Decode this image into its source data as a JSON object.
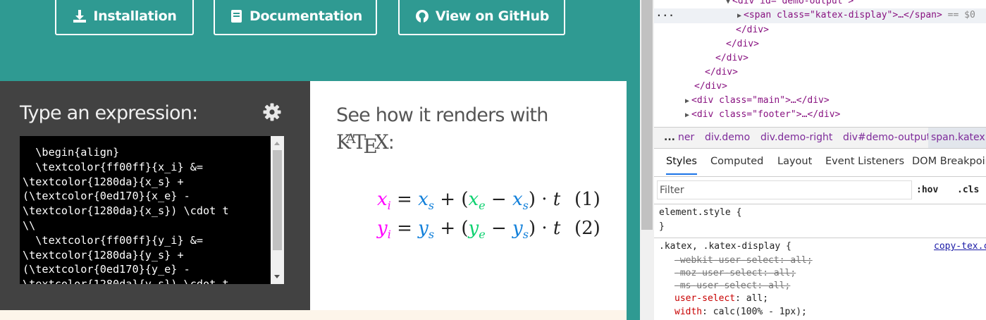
{
  "hero": {
    "installation": "Installation",
    "documentation": "Documentation",
    "github": "View on GitHub"
  },
  "demo": {
    "input_heading": "Type an expression:",
    "source": "  \\begin{align}\n  \\textcolor{ff00ff}{x_i} &=\n\\textcolor{1280da}{x_s} +\n(\\textcolor{0ed170}{x_e} -\n\\textcolor{1280da}{x_s}) \\cdot t\n\\\\\n  \\textcolor{ff00ff}{y_i} &=\n\\textcolor{1280da}{y_s} +\n(\\textcolor{0ed170}{y_e} -\n\\textcolor{1280da}{y_s}) \\cdot t",
    "output_heading": "See how it renders with",
    "logo": {
      "k": "K",
      "a": "A",
      "t": "T",
      "e": "E",
      "x": "X",
      "colon": ":"
    },
    "rows": [
      {
        "lhs": "x",
        "lhs_sub": "i",
        "a": "x",
        "a_sub": "s",
        "b": "x",
        "b_sub": "e",
        "c": "x",
        "c_sub": "s",
        "var": "t",
        "tag": "(1)"
      },
      {
        "lhs": "y",
        "lhs_sub": "i",
        "a": "y",
        "a_sub": "s",
        "b": "y",
        "b_sub": "e",
        "c": "y",
        "c_sub": "s",
        "var": "t",
        "tag": "(2)"
      }
    ],
    "colors": {
      "magenta": "#ff00ff",
      "blue": "#1280da",
      "green": "#0ed170"
    }
  },
  "devtools": {
    "dom": {
      "line0_open": "<div id=\"demo-output\">",
      "line1_tag": "<span class=\"katex-display\">",
      "line1_end": "…</span>",
      "line1_suffix": "== $0",
      "div_close": "</div>",
      "main_line": "<div class=\"main\">…</div>",
      "footer_line": "<div class=\"footer\">…</div>",
      "dots": "..."
    },
    "breadcrumbs": {
      "dots": "...",
      "items": [
        "ner",
        "div.demo",
        "div.demo-right",
        "div#demo-output",
        "span.katex"
      ]
    },
    "tabs": [
      "Styles",
      "Computed",
      "Layout",
      "Event Listeners",
      "DOM Breakpoints"
    ],
    "filter_placeholder": "Filter",
    "hov": ":hov",
    "cls": ".cls",
    "element_style": "element.style {",
    "close_brace": "}",
    "rule_selector": ".katex, .katex-display {",
    "rule_source": "copy-tex.css",
    "declarations": [
      {
        "prop": "-webkit-user-select",
        "value": "all;",
        "struck": true
      },
      {
        "prop": "-moz-user-select",
        "value": "all;",
        "struck": true
      },
      {
        "prop": "-ms-user-select",
        "value": "all;",
        "struck": true
      },
      {
        "prop": "user-select",
        "value": "all;",
        "struck": false
      },
      {
        "prop": "width",
        "value": "calc(100% - 1px);",
        "struck": false
      }
    ]
  }
}
